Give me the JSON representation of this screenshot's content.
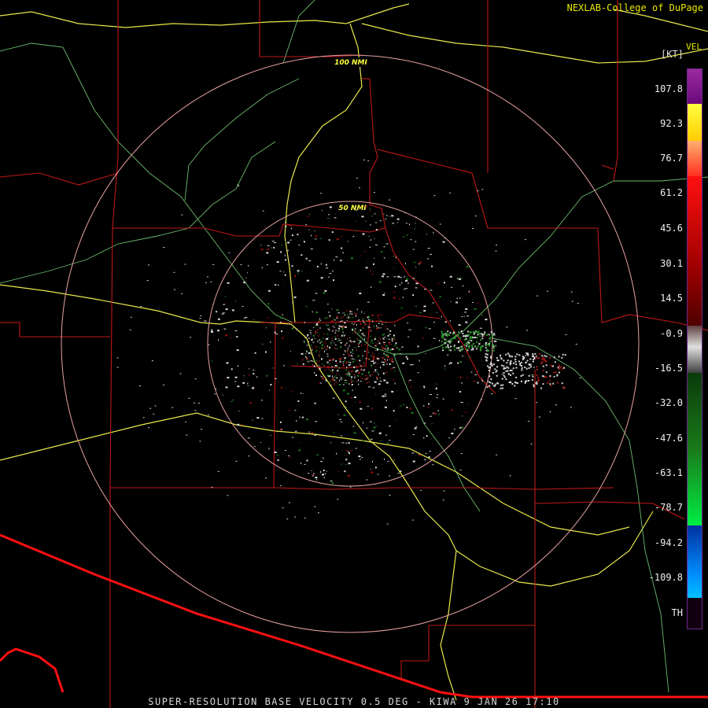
{
  "header": {
    "credit": "NEXLAB-College of DuPage",
    "product_code": "VEL",
    "unit": "[KT]"
  },
  "map": {
    "range_rings": [
      "100 NMI",
      "50 NMI"
    ]
  },
  "legend": {
    "ticks": [
      "107.8",
      "92.3",
      "76.7",
      "61.2",
      "45.6",
      "30.1",
      "14.5",
      "-0.9",
      "-16.5",
      "-32.0",
      "-47.6",
      "-63.1",
      "-78.7",
      "-94.2",
      "-109.8",
      "TH"
    ],
    "colors": {
      "purple": "#8a1a8a",
      "yellow": "#ffff00",
      "orange_red": "#ff2020",
      "dark_red": "#6a0000",
      "gray": "#c8c8c8",
      "dark_green": "#1a6a1a",
      "bright_green": "#00ee44",
      "blue": "#0050d0",
      "cyan": "#00b8ff"
    }
  },
  "footer": {
    "caption": "SUPER-RESOLUTION BASE VELOCITY 0.5 DEG - KIWA 9 JAN 26 17:10"
  }
}
